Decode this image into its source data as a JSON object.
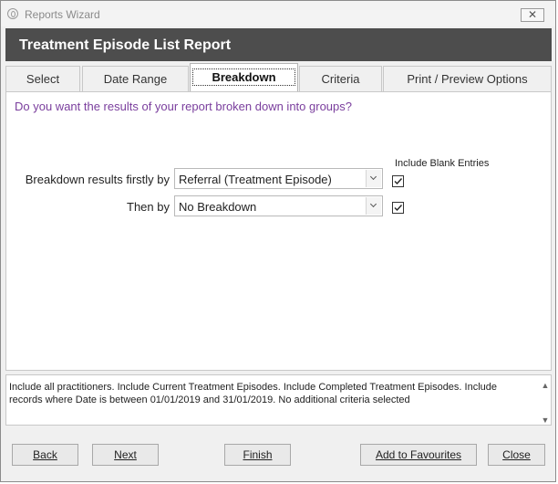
{
  "window": {
    "title": "Reports Wizard",
    "close_glyph": "✕"
  },
  "header": {
    "title": "Treatment Episode List Report"
  },
  "tabs": [
    {
      "label": "Select"
    },
    {
      "label": "Date Range"
    },
    {
      "label": "Breakdown",
      "active": true
    },
    {
      "label": "Criteria"
    },
    {
      "label": "Print / Preview Options"
    }
  ],
  "breakdown": {
    "question": "Do you want the results of your report broken down into groups?",
    "include_blank_header": "Include Blank Entries",
    "first": {
      "label": "Breakdown results firstly by",
      "value": "Referral (Treatment Episode)",
      "include_blank": true
    },
    "then": {
      "label": "Then by",
      "value": "No Breakdown",
      "include_blank": true
    }
  },
  "summary": "Include all practitioners. Include Current Treatment Episodes. Include Completed Treatment Episodes. Include records where Date is between 01/01/2019 and 31/01/2019. No additional criteria selected",
  "buttons": {
    "back": "Back",
    "next": "Next",
    "finish": "Finish",
    "add_to_favourites": "Add to Favourites",
    "close": "Close"
  },
  "colors": {
    "header_band": "#4d4d4d",
    "question_text": "#7a3e9d"
  },
  "icons": {
    "app": "app-logo-icon",
    "close": "close-icon",
    "dropdown": "chevron-down-icon",
    "check": "checkmark-icon",
    "scroll_up": "scroll-up-icon",
    "scroll_down": "scroll-down-icon"
  }
}
